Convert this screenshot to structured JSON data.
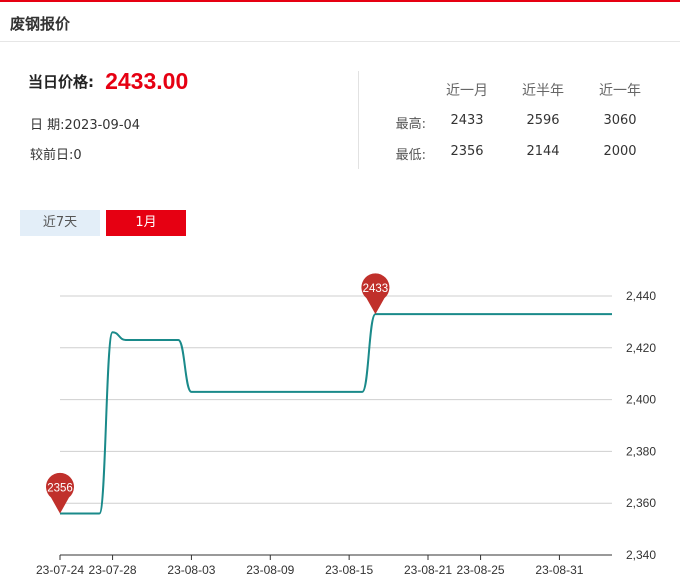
{
  "header": {
    "title": "废钢报价"
  },
  "price": {
    "label": "当日价格:",
    "value": "2433.00"
  },
  "meta": {
    "date": "日 期:2023-09-04",
    "diff": "较前日:0"
  },
  "stats": {
    "columns": [
      "近一月",
      "近半年",
      "近一年"
    ],
    "rows": [
      {
        "label": "最高:",
        "values": [
          "2433",
          "2596",
          "3060"
        ]
      },
      {
        "label": "最低:",
        "values": [
          "2356",
          "2144",
          "2000"
        ]
      }
    ]
  },
  "tabs": [
    {
      "label": "近7天",
      "active": false
    },
    {
      "label": "1月",
      "active": true
    }
  ],
  "colors": {
    "accent": "#e60012",
    "line": "#1a8a8a",
    "marker": "#c0302b",
    "inactive_tab": "#e3eef8"
  },
  "chart_data": {
    "type": "line",
    "x": [
      "23-07-24",
      "23-07-25",
      "23-07-26",
      "23-07-27",
      "23-07-28",
      "23-07-29",
      "23-07-30",
      "23-07-31",
      "23-08-01",
      "23-08-02",
      "23-08-03",
      "23-08-04",
      "23-08-05",
      "23-08-06",
      "23-08-07",
      "23-08-08",
      "23-08-09",
      "23-08-10",
      "23-08-11",
      "23-08-12",
      "23-08-13",
      "23-08-14",
      "23-08-15",
      "23-08-16",
      "23-08-17",
      "23-08-18",
      "23-08-19",
      "23-08-20",
      "23-08-21",
      "23-08-22",
      "23-08-23",
      "23-08-24",
      "23-08-25",
      "23-08-26",
      "23-08-27",
      "23-08-28",
      "23-08-29",
      "23-08-30",
      "23-08-31",
      "23-09-01",
      "23-09-04"
    ],
    "y": [
      2356,
      2356,
      2356,
      2356,
      2426,
      2423,
      2423,
      2423,
      2423,
      2423,
      2403,
      2403,
      2403,
      2403,
      2403,
      2403,
      2403,
      2403,
      2403,
      2403,
      2403,
      2403,
      2403,
      2403,
      2433,
      2433,
      2433,
      2433,
      2433,
      2433,
      2433,
      2433,
      2433,
      2433,
      2433,
      2433,
      2433,
      2433,
      2433,
      2433,
      2433
    ],
    "xticks": [
      "23-07-24",
      "23-07-28",
      "23-08-03",
      "23-08-09",
      "23-08-15",
      "23-08-21",
      "23-08-25",
      "23-08-31"
    ],
    "yticks": [
      "2,340",
      "2,360",
      "2,380",
      "2,400",
      "2,420",
      "2,440"
    ],
    "ylim": [
      2340,
      2440
    ],
    "markers": [
      {
        "label": "2356",
        "value": 2356,
        "x": "23-07-24"
      },
      {
        "label": "2433",
        "value": 2433,
        "x": "23-08-17"
      }
    ],
    "grid": true,
    "legend": "none"
  }
}
